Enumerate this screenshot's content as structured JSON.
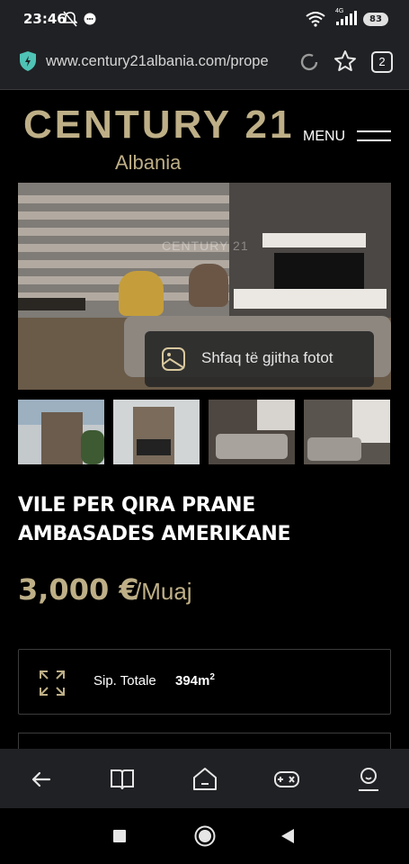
{
  "status_bar": {
    "time": "23:46",
    "network_label": "4G",
    "battery": "83",
    "icons": [
      "bell-off-icon",
      "chat-icon",
      "wifi-icon",
      "signal-icon",
      "battery-icon"
    ]
  },
  "browser": {
    "url": "www.century21albania.com/prope",
    "tab_count": "2",
    "icons": [
      "shield-icon",
      "reload-icon",
      "star-icon",
      "tabs-icon"
    ]
  },
  "site_header": {
    "brand": "CENTURY 21",
    "trademark": ".",
    "brand_sub": "Albania",
    "menu_label": "MENU"
  },
  "hero": {
    "watermark": "CENTURY 21",
    "show_all_photos": "Shfaq të gjitha fotot"
  },
  "thumbnails": [
    {
      "label": "exterior-front"
    },
    {
      "label": "exterior-side"
    },
    {
      "label": "living-room"
    },
    {
      "label": "living-room-stairs"
    }
  ],
  "listing": {
    "title": "VILE PER QIRA PRANE AMBASADES AMERIKANE",
    "price": "3,000 €",
    "price_unit": "/Muaj"
  },
  "specs": [
    {
      "label": "Sip. Totale",
      "value": "394m",
      "unit_sup": "2"
    }
  ],
  "bottom_toolbar": {
    "items": [
      "back-icon",
      "book-icon",
      "home-icon",
      "game-icon",
      "profile-icon"
    ]
  },
  "system_nav": {
    "items": [
      "recents-icon",
      "home-circle-icon",
      "back-triangle-icon"
    ]
  },
  "colors": {
    "brand_gold": "#beaf87",
    "background": "#000000",
    "chrome": "#202124"
  }
}
